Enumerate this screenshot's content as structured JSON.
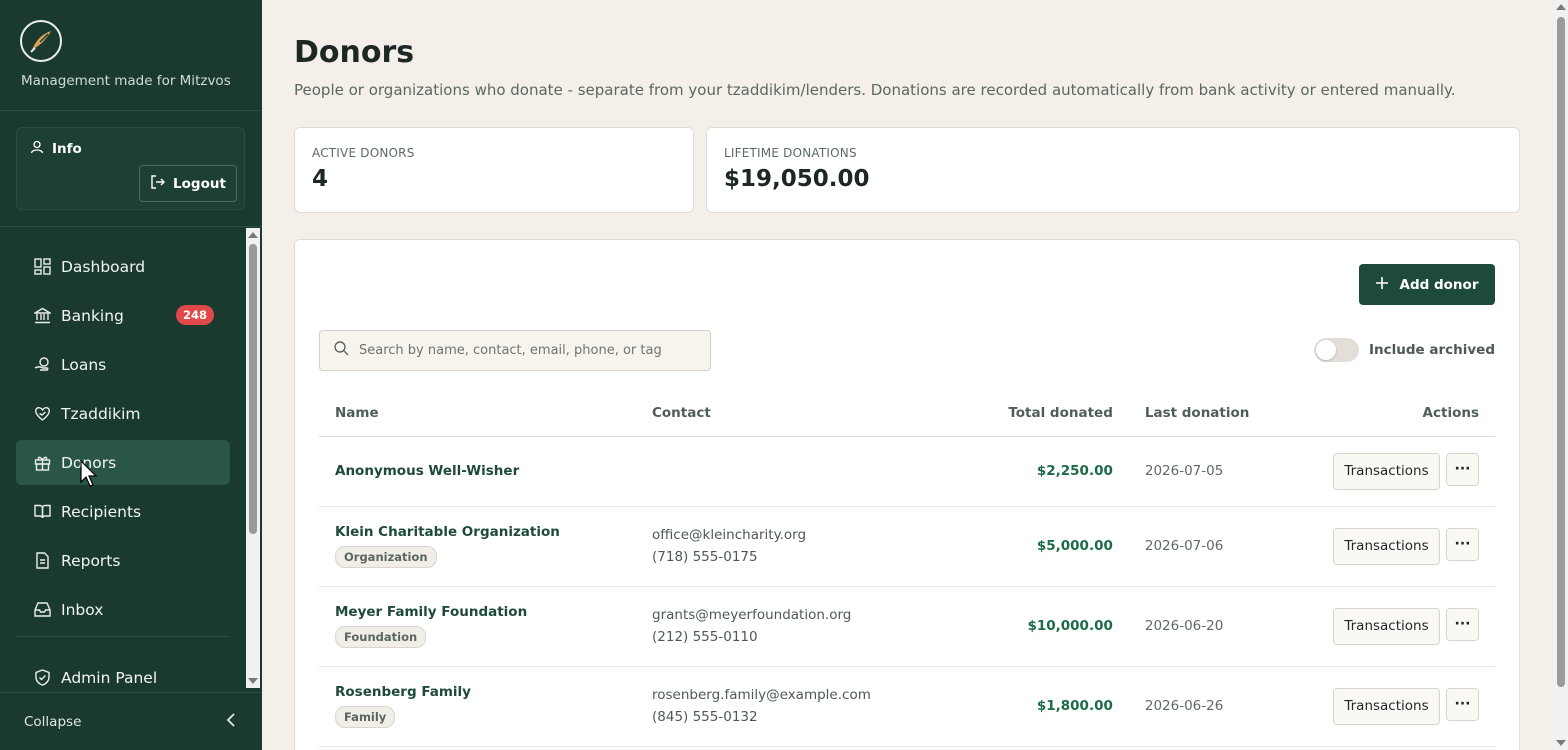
{
  "sidebar": {
    "tagline": "Management made for Mitzvos",
    "user_label": "Info",
    "logout_label": "Logout",
    "nav": [
      {
        "label": "Dashboard",
        "icon": "dashboard-icon"
      },
      {
        "label": "Banking",
        "icon": "bank-icon",
        "badge": "248"
      },
      {
        "label": "Loans",
        "icon": "loans-icon"
      },
      {
        "label": "Tzaddikim",
        "icon": "heart-hand-icon"
      },
      {
        "label": "Donors",
        "icon": "gift-icon",
        "active": true
      },
      {
        "label": "Recipients",
        "icon": "book-icon"
      },
      {
        "label": "Reports",
        "icon": "report-icon"
      },
      {
        "label": "Inbox",
        "icon": "inbox-icon"
      }
    ],
    "admin_label": "Admin Panel",
    "collapse_label": "Collapse"
  },
  "page": {
    "title": "Donors",
    "description": "People or organizations who donate - separate from your tzaddikim/lenders. Donations are recorded automatically from bank activity or entered manually."
  },
  "stats": {
    "active_label": "ACTIVE DONORS",
    "active_value": "4",
    "lifetime_label": "LIFETIME DONATIONS",
    "lifetime_value": "$19,050.00"
  },
  "toolbar": {
    "add_label": "Add donor",
    "search_placeholder": "Search by name, contact, email, phone, or tag",
    "archived_label": "Include archived"
  },
  "table": {
    "headers": {
      "name": "Name",
      "contact": "Contact",
      "total": "Total donated",
      "last": "Last donation",
      "actions": "Actions"
    },
    "action_label": "Transactions",
    "more_label": "···",
    "rows": [
      {
        "name": "Anonymous Well-Wisher",
        "tag": "",
        "email": "",
        "phone": "",
        "total": "$2,250.00",
        "last": "2026-07-05"
      },
      {
        "name": "Klein Charitable Organization",
        "tag": "Organization",
        "email": "office@kleincharity.org",
        "phone": "(718) 555-0175",
        "total": "$5,000.00",
        "last": "2026-07-06"
      },
      {
        "name": "Meyer Family Foundation",
        "tag": "Foundation",
        "email": "grants@meyerfoundation.org",
        "phone": "(212) 555-0110",
        "total": "$10,000.00",
        "last": "2026-06-20"
      },
      {
        "name": "Rosenberg Family",
        "tag": "Family",
        "email": "rosenberg.family@example.com",
        "phone": "(845) 555-0132",
        "total": "$1,800.00",
        "last": "2026-06-26"
      }
    ]
  },
  "colors": {
    "sidebar_bg": "#1b3a2f",
    "accent": "#1e4a39",
    "amount": "#1e6b47",
    "badge": "#e0484a",
    "page_bg": "#f4f0e9"
  }
}
